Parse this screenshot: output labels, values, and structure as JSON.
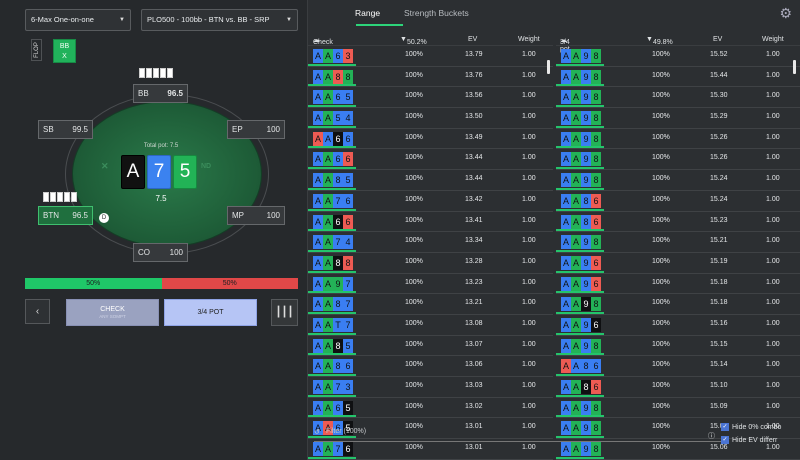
{
  "header": {
    "game_select": "6-Max One-on-one",
    "scenario_select": "PLO500 - 100bb - BTN vs. BB - SRP"
  },
  "street_tag": "FLOP",
  "player_tag": {
    "line1": "BB",
    "line2": "X"
  },
  "table": {
    "total_pot_label": "Total pot: 7.5",
    "pot_value": "7.5",
    "logo_text_left": "",
    "logo_text_right": "ND",
    "board": [
      {
        "rank": "A",
        "suit": "black"
      },
      {
        "rank": "7",
        "suit": "blue"
      },
      {
        "rank": "5",
        "suit": "green"
      }
    ],
    "seats": {
      "bb": {
        "name": "BB",
        "stack": "96.5"
      },
      "sb": {
        "name": "SB",
        "stack": "99.5"
      },
      "ep": {
        "name": "EP",
        "stack": "100"
      },
      "btn": {
        "name": "BTN",
        "stack": "96.5"
      },
      "mp": {
        "name": "MP",
        "stack": "100"
      },
      "co": {
        "name": "CO",
        "stack": "100"
      }
    },
    "dealer_button": "D"
  },
  "equity": {
    "left": "50%",
    "right": "50%",
    "left_fraction": 0.5
  },
  "actions": {
    "back": "‹",
    "check_label": "CHECK",
    "check_sub": "ANY SOMPT",
    "bet_label": "3/4 POT"
  },
  "tabs": [
    {
      "label": "Range",
      "active": true
    },
    {
      "label": "Strength Buckets",
      "active": false
    }
  ],
  "columns": {
    "left": {
      "action": "Check",
      "freq": "50.2%",
      "ev": "EV",
      "weight": "Weight"
    },
    "right": {
      "action": "3/4 pot",
      "freq": "49.8%",
      "ev": "EV",
      "weight": "Weight"
    }
  },
  "left_rows": [
    {
      "cards": [
        [
          "A",
          "b"
        ],
        [
          "A",
          "g"
        ],
        [
          "6",
          "b"
        ],
        [
          "3",
          "r"
        ]
      ],
      "pct": "100%",
      "ev": "13.79",
      "w": "1.00"
    },
    {
      "cards": [
        [
          "A",
          "b"
        ],
        [
          "A",
          "g"
        ],
        [
          "8",
          "r"
        ],
        [
          "8",
          "g"
        ]
      ],
      "pct": "100%",
      "ev": "13.76",
      "w": "1.00"
    },
    {
      "cards": [
        [
          "A",
          "b"
        ],
        [
          "A",
          "g"
        ],
        [
          "6",
          "b"
        ],
        [
          "5",
          "b"
        ]
      ],
      "pct": "100%",
      "ev": "13.56",
      "w": "1.00"
    },
    {
      "cards": [
        [
          "A",
          "b"
        ],
        [
          "A",
          "g"
        ],
        [
          "5",
          "b"
        ],
        [
          "4",
          "b"
        ]
      ],
      "pct": "100%",
      "ev": "13.50",
      "w": "1.00"
    },
    {
      "cards": [
        [
          "A",
          "r"
        ],
        [
          "A",
          "b"
        ],
        [
          "6",
          "k"
        ],
        [
          "6",
          "b"
        ]
      ],
      "pct": "100%",
      "ev": "13.49",
      "w": "1.00"
    },
    {
      "cards": [
        [
          "A",
          "b"
        ],
        [
          "A",
          "g"
        ],
        [
          "6",
          "b"
        ],
        [
          "6",
          "r"
        ]
      ],
      "pct": "100%",
      "ev": "13.44",
      "w": "1.00"
    },
    {
      "cards": [
        [
          "A",
          "b"
        ],
        [
          "A",
          "g"
        ],
        [
          "8",
          "b"
        ],
        [
          "5",
          "b"
        ]
      ],
      "pct": "100%",
      "ev": "13.44",
      "w": "1.00"
    },
    {
      "cards": [
        [
          "A",
          "b"
        ],
        [
          "A",
          "g"
        ],
        [
          "7",
          "b"
        ],
        [
          "6",
          "b"
        ]
      ],
      "pct": "100%",
      "ev": "13.42",
      "w": "1.00"
    },
    {
      "cards": [
        [
          "A",
          "b"
        ],
        [
          "A",
          "g"
        ],
        [
          "6",
          "k"
        ],
        [
          "6",
          "r"
        ]
      ],
      "pct": "100%",
      "ev": "13.41",
      "w": "1.00"
    },
    {
      "cards": [
        [
          "A",
          "b"
        ],
        [
          "A",
          "g"
        ],
        [
          "7",
          "b"
        ],
        [
          "4",
          "b"
        ]
      ],
      "pct": "100%",
      "ev": "13.34",
      "w": "1.00"
    },
    {
      "cards": [
        [
          "A",
          "b"
        ],
        [
          "A",
          "g"
        ],
        [
          "8",
          "k"
        ],
        [
          "8",
          "r"
        ]
      ],
      "pct": "100%",
      "ev": "13.28",
      "w": "1.00"
    },
    {
      "cards": [
        [
          "A",
          "b"
        ],
        [
          "A",
          "g"
        ],
        [
          "9",
          "g"
        ],
        [
          "7",
          "b"
        ]
      ],
      "pct": "100%",
      "ev": "13.23",
      "w": "1.00"
    },
    {
      "cards": [
        [
          "A",
          "b"
        ],
        [
          "A",
          "g"
        ],
        [
          "8",
          "b"
        ],
        [
          "7",
          "b"
        ]
      ],
      "pct": "100%",
      "ev": "13.21",
      "w": "1.00"
    },
    {
      "cards": [
        [
          "A",
          "b"
        ],
        [
          "A",
          "g"
        ],
        [
          "T",
          "b"
        ],
        [
          "7",
          "b"
        ]
      ],
      "pct": "100%",
      "ev": "13.08",
      "w": "1.00"
    },
    {
      "cards": [
        [
          "A",
          "b"
        ],
        [
          "A",
          "g"
        ],
        [
          "8",
          "k"
        ],
        [
          "5",
          "b"
        ]
      ],
      "pct": "100%",
      "ev": "13.07",
      "w": "1.00"
    },
    {
      "cards": [
        [
          "A",
          "b"
        ],
        [
          "A",
          "g"
        ],
        [
          "8",
          "b"
        ],
        [
          "6",
          "b"
        ]
      ],
      "pct": "100%",
      "ev": "13.06",
      "w": "1.00"
    },
    {
      "cards": [
        [
          "A",
          "b"
        ],
        [
          "A",
          "g"
        ],
        [
          "7",
          "b"
        ],
        [
          "3",
          "b"
        ]
      ],
      "pct": "100%",
      "ev": "13.03",
      "w": "1.00"
    },
    {
      "cards": [
        [
          "A",
          "b"
        ],
        [
          "A",
          "g"
        ],
        [
          "6",
          "b"
        ],
        [
          "5",
          "k"
        ]
      ],
      "pct": "100%",
      "ev": "13.02",
      "w": "1.00"
    },
    {
      "cards": [
        [
          "A",
          "b"
        ],
        [
          "A",
          "r"
        ],
        [
          "6",
          "b"
        ],
        [
          "5",
          "k"
        ]
      ],
      "pct": "100%",
      "ev": "13.01",
      "w": "1.00"
    },
    {
      "cards": [
        [
          "A",
          "b"
        ],
        [
          "A",
          "g"
        ],
        [
          "7",
          "b"
        ],
        [
          "6",
          "k"
        ]
      ],
      "pct": "100%",
      "ev": "13.01",
      "w": "1.00"
    }
  ],
  "right_rows": [
    {
      "cards": [
        [
          "A",
          "b"
        ],
        [
          "A",
          "g"
        ],
        [
          "9",
          "b"
        ],
        [
          "8",
          "g"
        ]
      ],
      "pct": "100%",
      "ev": "15.52",
      "w": "1.00"
    },
    {
      "cards": [
        [
          "A",
          "b"
        ],
        [
          "A",
          "g"
        ],
        [
          "9",
          "b"
        ],
        [
          "8",
          "g"
        ]
      ],
      "pct": "100%",
      "ev": "15.44",
      "w": "1.00"
    },
    {
      "cards": [
        [
          "A",
          "b"
        ],
        [
          "A",
          "g"
        ],
        [
          "9",
          "b"
        ],
        [
          "8",
          "g"
        ]
      ],
      "pct": "100%",
      "ev": "15.30",
      "w": "1.00"
    },
    {
      "cards": [
        [
          "A",
          "b"
        ],
        [
          "A",
          "g"
        ],
        [
          "9",
          "b"
        ],
        [
          "8",
          "g"
        ]
      ],
      "pct": "100%",
      "ev": "15.29",
      "w": "1.00"
    },
    {
      "cards": [
        [
          "A",
          "b"
        ],
        [
          "A",
          "g"
        ],
        [
          "9",
          "b"
        ],
        [
          "8",
          "g"
        ]
      ],
      "pct": "100%",
      "ev": "15.26",
      "w": "1.00"
    },
    {
      "cards": [
        [
          "A",
          "b"
        ],
        [
          "A",
          "g"
        ],
        [
          "9",
          "b"
        ],
        [
          "8",
          "g"
        ]
      ],
      "pct": "100%",
      "ev": "15.26",
      "w": "1.00"
    },
    {
      "cards": [
        [
          "A",
          "b"
        ],
        [
          "A",
          "g"
        ],
        [
          "9",
          "b"
        ],
        [
          "8",
          "g"
        ]
      ],
      "pct": "100%",
      "ev": "15.24",
      "w": "1.00"
    },
    {
      "cards": [
        [
          "A",
          "b"
        ],
        [
          "A",
          "g"
        ],
        [
          "8",
          "b"
        ],
        [
          "6",
          "r"
        ]
      ],
      "pct": "100%",
      "ev": "15.24",
      "w": "1.00"
    },
    {
      "cards": [
        [
          "A",
          "b"
        ],
        [
          "A",
          "g"
        ],
        [
          "8",
          "b"
        ],
        [
          "6",
          "r"
        ]
      ],
      "pct": "100%",
      "ev": "15.23",
      "w": "1.00"
    },
    {
      "cards": [
        [
          "A",
          "b"
        ],
        [
          "A",
          "g"
        ],
        [
          "9",
          "b"
        ],
        [
          "8",
          "g"
        ]
      ],
      "pct": "100%",
      "ev": "15.21",
      "w": "1.00"
    },
    {
      "cards": [
        [
          "A",
          "b"
        ],
        [
          "A",
          "g"
        ],
        [
          "9",
          "b"
        ],
        [
          "6",
          "r"
        ]
      ],
      "pct": "100%",
      "ev": "15.19",
      "w": "1.00"
    },
    {
      "cards": [
        [
          "A",
          "b"
        ],
        [
          "A",
          "g"
        ],
        [
          "9",
          "b"
        ],
        [
          "6",
          "r"
        ]
      ],
      "pct": "100%",
      "ev": "15.18",
      "w": "1.00"
    },
    {
      "cards": [
        [
          "A",
          "b"
        ],
        [
          "A",
          "g"
        ],
        [
          "9",
          "k"
        ],
        [
          "8",
          "g"
        ]
      ],
      "pct": "100%",
      "ev": "15.18",
      "w": "1.00"
    },
    {
      "cards": [
        [
          "A",
          "b"
        ],
        [
          "A",
          "g"
        ],
        [
          "9",
          "b"
        ],
        [
          "6",
          "k"
        ]
      ],
      "pct": "100%",
      "ev": "15.16",
      "w": "1.00"
    },
    {
      "cards": [
        [
          "A",
          "b"
        ],
        [
          "A",
          "g"
        ],
        [
          "9",
          "b"
        ],
        [
          "8",
          "g"
        ]
      ],
      "pct": "100%",
      "ev": "15.15",
      "w": "1.00"
    },
    {
      "cards": [
        [
          "A",
          "r"
        ],
        [
          "A",
          "b"
        ],
        [
          "8",
          "b"
        ],
        [
          "6",
          "b"
        ]
      ],
      "pct": "100%",
      "ev": "15.14",
      "w": "1.00"
    },
    {
      "cards": [
        [
          "A",
          "b"
        ],
        [
          "A",
          "g"
        ],
        [
          "8",
          "k"
        ],
        [
          "6",
          "r"
        ]
      ],
      "pct": "100%",
      "ev": "15.10",
      "w": "1.00"
    },
    {
      "cards": [
        [
          "A",
          "b"
        ],
        [
          "A",
          "g"
        ],
        [
          "9",
          "b"
        ],
        [
          "8",
          "g"
        ]
      ],
      "pct": "100%",
      "ev": "15.09",
      "w": "1.00"
    },
    {
      "cards": [
        [
          "A",
          "b"
        ],
        [
          "A",
          "g"
        ],
        [
          "9",
          "b"
        ],
        [
          "8",
          "g"
        ]
      ],
      "pct": "100%",
      "ev": "15.09",
      "w": "1.00"
    },
    {
      "cards": [
        [
          "A",
          "b"
        ],
        [
          "A",
          "g"
        ],
        [
          "9",
          "b"
        ],
        [
          "8",
          "g"
        ]
      ],
      "pct": "100%",
      "ev": "15.06",
      "w": "1.00"
    }
  ],
  "footer": {
    "filter_placeholder": "Filter (100%)",
    "hide_zero": "Hide 0% combo",
    "hide_ev": "Hide EV differr"
  },
  "colors": {
    "accent_green": "#2dd47a",
    "suit_blue": "#3a7ef2",
    "suit_green": "#23b257",
    "suit_red": "#ee5b53",
    "suit_black": "#0f1012"
  }
}
